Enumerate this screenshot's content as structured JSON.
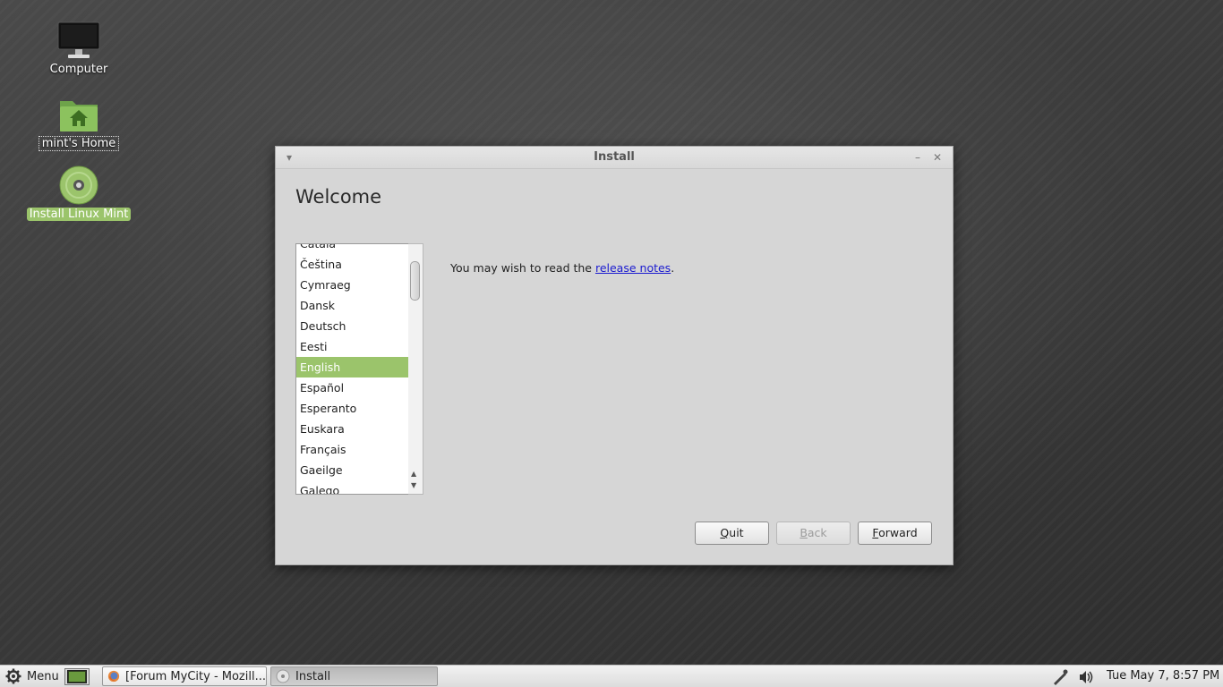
{
  "desktop": {
    "icons": [
      {
        "label": "Computer"
      },
      {
        "label": "mint's Home"
      },
      {
        "label": "Install Linux Mint"
      }
    ]
  },
  "window": {
    "title": "Install",
    "heading": "Welcome",
    "languages": [
      "Català",
      "Čeština",
      "Cymraeg",
      "Dansk",
      "Deutsch",
      "Eesti",
      "English",
      "Español",
      "Esperanto",
      "Euskara",
      "Français",
      "Gaeilge",
      "Galego"
    ],
    "selected_language": "English",
    "notes_prefix": "You may wish to read the ",
    "notes_link": "release notes",
    "notes_suffix": ".",
    "buttons": {
      "quit_mnemonic": "Q",
      "quit_rest": "uit",
      "back_mnemonic": "B",
      "back_rest": "ack",
      "forward_mnemonic": "F",
      "forward_rest": "orward"
    }
  },
  "taskbar": {
    "menu_label": "Menu",
    "tasks": [
      {
        "label": "[Forum MyCity - Mozill..."
      },
      {
        "label": "Install"
      }
    ],
    "clock": "Tue May 7, 8:57 PM"
  },
  "colors": {
    "selection_green": "#9bc46b",
    "link_blue": "#1a1ad0"
  }
}
